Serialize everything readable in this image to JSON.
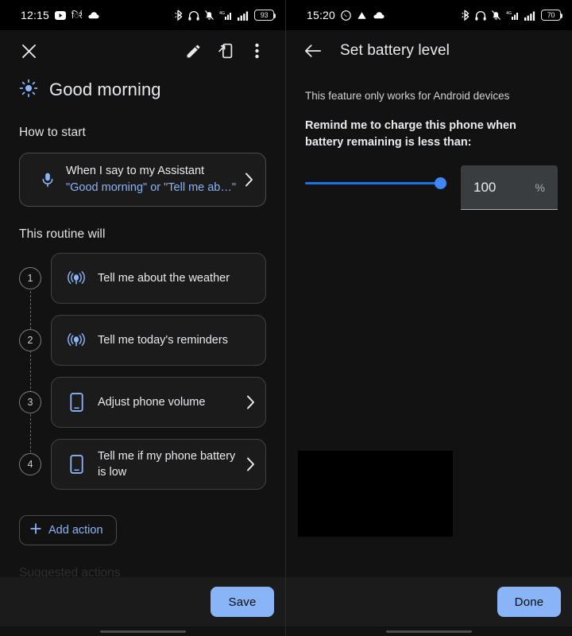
{
  "left": {
    "statusbar": {
      "time": "12:15",
      "left_icons": [
        "youtube-icon",
        "hindi-text-icon",
        "cloud-icon"
      ],
      "right_icons": [
        "bluetooth-icon",
        "headphones-icon",
        "notifications-muted-icon",
        "wifi-icon",
        "signal-icon"
      ],
      "battery": "93"
    },
    "toolbar": {
      "close_label": "close-icon",
      "edit_label": "edit-pencil-icon",
      "cast_label": "move-to-device-icon",
      "overflow_label": "more-options-icon"
    },
    "title": "Good morning",
    "how_to_start_label": "How to start",
    "starter": {
      "title": "When I say to my Assistant",
      "subtitle": "\"Good morning\" or \"Tell me ab…\""
    },
    "routine_label": "This routine will",
    "steps": [
      {
        "num": "1",
        "label": "Tell me about the weather",
        "icon": "speaker-broadcast-icon",
        "chevron": false
      },
      {
        "num": "2",
        "label": "Tell me today's reminders",
        "icon": "speaker-broadcast-icon",
        "chevron": false
      },
      {
        "num": "3",
        "label": "Adjust phone volume",
        "icon": "phone-icon",
        "chevron": true
      },
      {
        "num": "4",
        "label": "Tell me if my phone battery is low",
        "icon": "phone-icon",
        "chevron": true
      }
    ],
    "add_action_label": "Add action",
    "suggested_label": "Suggested actions",
    "save_label": "Save"
  },
  "right": {
    "statusbar": {
      "time": "15:20",
      "left_icons": [
        "whatsapp-icon",
        "drive-icon",
        "cloud-icon"
      ],
      "right_icons": [
        "bluetooth-icon",
        "headphones-icon",
        "notifications-muted-icon",
        "wifi-icon",
        "signal-icon"
      ],
      "battery": "70"
    },
    "title": "Set battery level",
    "note": "This feature only works for Android devices",
    "prompt": "Remind me to charge this phone when battery remaining is less than:",
    "slider": {
      "value": 100,
      "min": 0,
      "max": 100
    },
    "field": {
      "value": "100",
      "unit": "%"
    },
    "done_label": "Done"
  },
  "colors": {
    "accent_blue": "#8ab4f8",
    "slider_blue": "#1a73e8",
    "background": "#121212",
    "card": "#1b1b1b"
  }
}
